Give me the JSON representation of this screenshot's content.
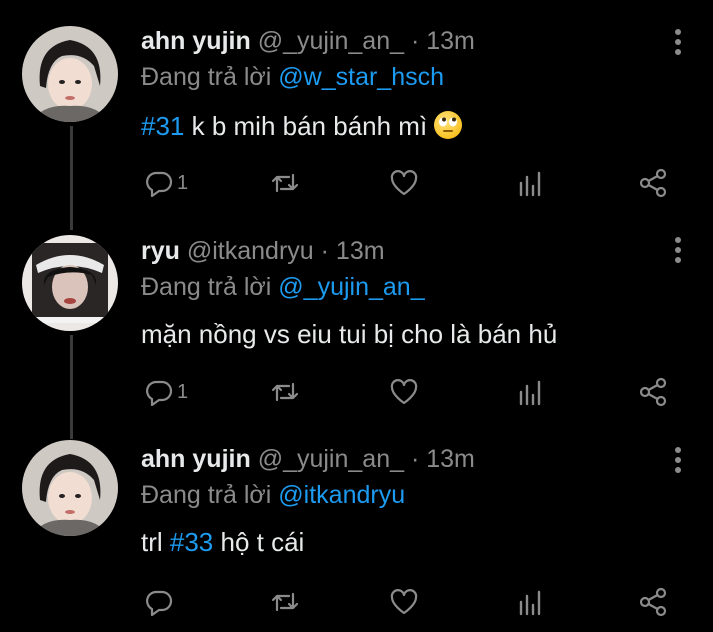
{
  "tweets": [
    {
      "name": "ahn yujin",
      "handle": "@_yujin_an_",
      "dot": "·",
      "time": "13m",
      "replying_prefix": "Đang trả lời",
      "replying_to": "@w_star_hsch",
      "hashtag": "#31",
      "text": " k b mih bán bánh mì ",
      "emoji": "face-with-rolling-eyes",
      "reply_count": "1",
      "avatar": "avatar-yujin"
    },
    {
      "name": "ryu",
      "handle": "@itkandryu",
      "dot": "·",
      "time": "13m",
      "replying_prefix": "Đang trả lời",
      "replying_to": "@_yujin_an_",
      "text": "mặn nồng vs eiu tui bị cho là bán hủ",
      "reply_count": "1",
      "avatar": "avatar-ryu"
    },
    {
      "name": "ahn yujin",
      "handle": "@_yujin_an_",
      "dot": "·",
      "time": "13m",
      "replying_prefix": "Đang trả lời",
      "replying_to": "@itkandryu",
      "text_before": "trl ",
      "hashtag": "#33",
      "text_after": " hộ t cái",
      "reply_count": "",
      "avatar": "avatar-yujin"
    }
  ],
  "colors": {
    "background": "#000000",
    "text": "#e7e9ea",
    "muted": "#8b8b8b",
    "link": "#1d9bf0"
  },
  "icons": [
    "reply-icon",
    "retweet-icon",
    "like-icon",
    "analytics-icon",
    "share-icon",
    "more-icon"
  ]
}
